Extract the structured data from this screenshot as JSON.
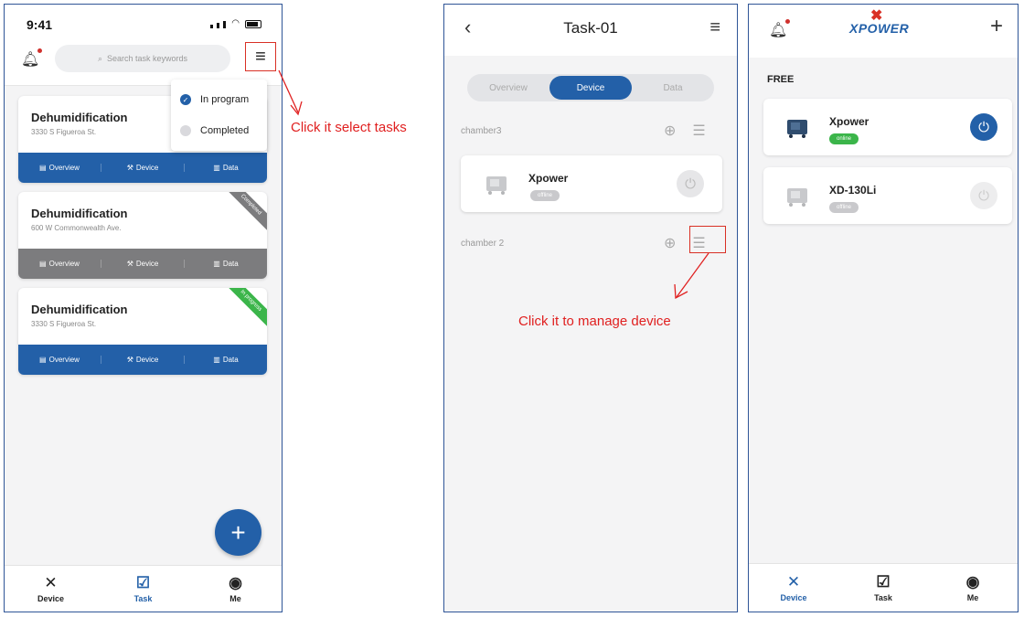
{
  "screen1": {
    "status_time": "9:41",
    "search_placeholder": "Search task keywords",
    "dropdown": {
      "options": [
        {
          "label": "In program",
          "selected": true
        },
        {
          "label": "Completed",
          "selected": false
        }
      ]
    },
    "cards": [
      {
        "title": "Dehumidification",
        "address": "3330 S Figueroa St.",
        "ribbon": "",
        "bar_color": "#2360a8"
      },
      {
        "title": "Dehumidification",
        "address": "600 W Commonwealth Ave.",
        "ribbon": "Completed",
        "ribbon_color": "#7c7c7e",
        "bar_color": "#7c7c7e"
      },
      {
        "title": "Dehumidification",
        "address": "3330 S Figueroa St.",
        "ribbon": "In progress",
        "ribbon_color": "#3bb54a",
        "bar_color": "#2360a8"
      }
    ],
    "card_actions": [
      "Overview",
      "Device",
      "Data"
    ],
    "fab_icon": "plus-icon",
    "tabs": [
      {
        "label": "Device",
        "icon": "xpower-logo-icon",
        "active": false
      },
      {
        "label": "Task",
        "icon": "clipboard-check-icon",
        "active": true
      },
      {
        "label": "Me",
        "icon": "user-circle-icon",
        "active": false
      }
    ],
    "annotation": "Click it select tasks"
  },
  "screen2": {
    "title": "Task-01",
    "segments": [
      {
        "label": "Overview",
        "active": false
      },
      {
        "label": "Device",
        "active": true
      },
      {
        "label": "Data",
        "active": false
      }
    ],
    "groups": [
      {
        "name": "chamber3"
      },
      {
        "name": "chamber 2"
      }
    ],
    "device": {
      "name": "Xpower",
      "status": "offline"
    },
    "annotation": "Click it to manage device"
  },
  "screen3": {
    "logo_text": "XPOWER",
    "section": "FREE",
    "devices": [
      {
        "name": "Xpower",
        "status": "online",
        "power_on": true
      },
      {
        "name": "XD-130Li",
        "status": "offline",
        "power_on": false
      }
    ],
    "tabs": [
      {
        "label": "Device",
        "icon": "xpower-logo-icon",
        "active": true
      },
      {
        "label": "Task",
        "icon": "clipboard-check-icon",
        "active": false
      },
      {
        "label": "Me",
        "icon": "user-circle-icon",
        "active": false
      }
    ]
  },
  "colors": {
    "primary": "#2360a8",
    "annotation": "#e02020",
    "online": "#3bb54a",
    "offline": "#c9c9cc"
  }
}
